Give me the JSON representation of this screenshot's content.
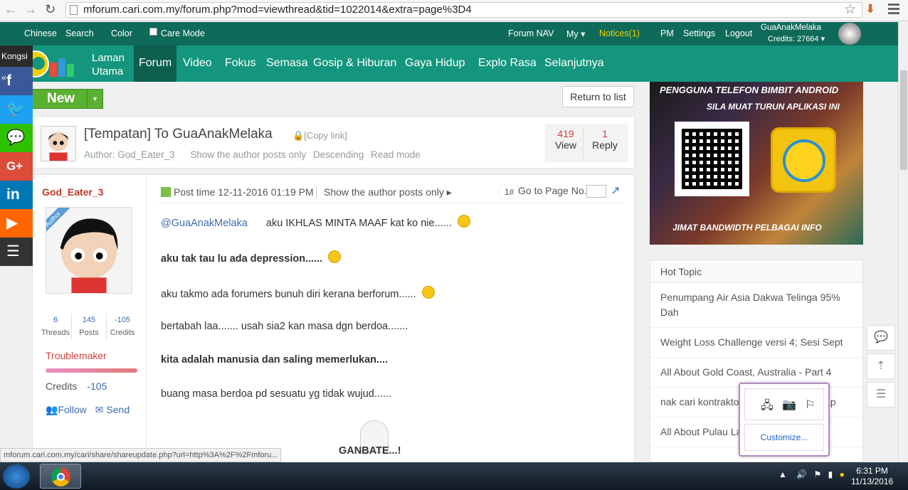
{
  "browser": {
    "url": "mforum.cari.com.my/forum.php?mod=viewthread&tid=1022014&extra=page%3D4",
    "back": "←",
    "forward": "→",
    "reload": "↻",
    "star": "☆",
    "download": "⬇"
  },
  "topbar": {
    "chinese": "Chinese",
    "search": "Search",
    "color": "Color",
    "care_mode": "Care Mode",
    "forum_nav": "Forum NAV",
    "my": "My",
    "notices": "Notices(1)",
    "pm": "PM",
    "settings": "Settings",
    "logout": "Logout",
    "username": "GuaAnakMelaka",
    "credits": "Credits: 27664"
  },
  "nav": {
    "home_l1": "Laman",
    "home_l2": "Utama",
    "items": [
      "Forum",
      "Video",
      "Fokus",
      "Semasa",
      "Gosip & Hiburan",
      "Gaya Hidup",
      "Explo Rasa",
      "Selanjutnya"
    ],
    "active_color": "#0c5f4f"
  },
  "actions": {
    "new": "New",
    "return": "Return to list"
  },
  "thread": {
    "title": "[Tempatan] To GuaAnakMelaka",
    "copy": "[Copy link]",
    "author": "Author: God_Eater_3",
    "show_author": "Show the author posts only",
    "descending": "Descending",
    "read_mode": "Read mode",
    "views": "419",
    "views_label": "View",
    "replies": "1",
    "replies_label": "Reply"
  },
  "share": {
    "label": "Kongsi",
    "colors": [
      "#3b5998",
      "#1da1f2",
      "#2dc100",
      "#dd4b39",
      "#0077b5",
      "#ff6600",
      "#333333"
    ]
  },
  "user": {
    "name": "God_Eater_3",
    "badge": "Author",
    "threads": "6",
    "threads_label": "Threads",
    "posts": "145",
    "posts_label": "Posts",
    "credits": "-105",
    "credits_label": "Credits",
    "rank": "Troublemaker",
    "credits_row": "Credits",
    "credits_row_val": "-105",
    "follow": "Follow",
    "send": "Send"
  },
  "post": {
    "time": "Post time 12-11-2016 01:19 PM",
    "show_author": "Show the author posts only",
    "floor": "1#",
    "goto": "Go to Page No.",
    "mention": "@GuaAnakMelaka",
    "l1": "aku IKHLAS MINTA MAAF kat ko nie......",
    "l2": "aku tak tau lu ada depression......",
    "l3": "aku takmo ada forumers bunuh diri kerana berforum......",
    "l4": "bertabah laa....... usah sia2 kan masa dgn berdoa.......",
    "l5": "kita adalah manusia dan saling memerlukan....",
    "l6": "buang masa berdoa pd sesuatu yg tidak wujud......",
    "l7": "GANBATE...!"
  },
  "banner": {
    "t1": "PENGGUNA TELEFON BIMBIT ANDROID",
    "t2": "SILA MUAT TURUN APLIKASI INI",
    "t3": "JIMAT BANDWIDTH   PELBAGAI INFO"
  },
  "hot": {
    "title": "Hot Topic",
    "items": [
      "Penumpang Air Asia Dakwa Telinga 95% Dah",
      "Weight Loss Challenge versi 4; Sesi Sept",
      "All About Gold Coast, Australia - Part 4",
      "nak cari kontraktor ubah suai rumah tap",
      "All About Pulau Langkawi"
    ]
  },
  "popup": {
    "customize": "Customize..."
  },
  "status_url": "mforum.cari.com.my/cari/share/shareupdate.php?url=http%3A%2F%2Fmforu...",
  "clock": {
    "time": "6:31 PM",
    "date": "11/13/2016"
  }
}
